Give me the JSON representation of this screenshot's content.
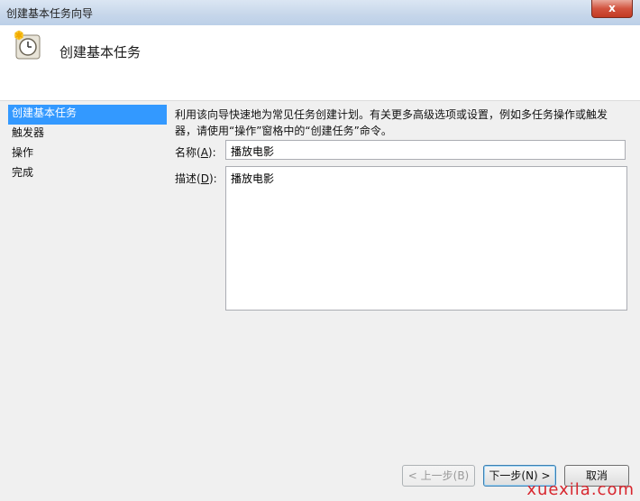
{
  "window": {
    "title": "创建基本任务向导",
    "close_label": "x"
  },
  "header": {
    "title": "创建基本任务",
    "icon": "clock-icon"
  },
  "nav": {
    "items": [
      {
        "label": "创建基本任务"
      },
      {
        "label": "触发器"
      },
      {
        "label": "操作"
      },
      {
        "label": "完成"
      }
    ]
  },
  "form": {
    "intro_line1": "利用该向导快速地为常见任务创建计划。有关更多高级选项或设置，例如多任务操作或触发",
    "intro_line2": "器，请使用“操作”窗格中的“创建任务”命令。",
    "name_label": "名称(",
    "name_key": "A",
    "name_label_end": "):",
    "name_value": "播放电影",
    "desc_label": "描述(",
    "desc_key": "D",
    "desc_label_end": "):",
    "desc_value": "播放电影"
  },
  "buttons": {
    "back": "< 上一步(B)",
    "next": "下一步(N) >",
    "cancel": "取消"
  },
  "watermark": "xuexila.com"
}
